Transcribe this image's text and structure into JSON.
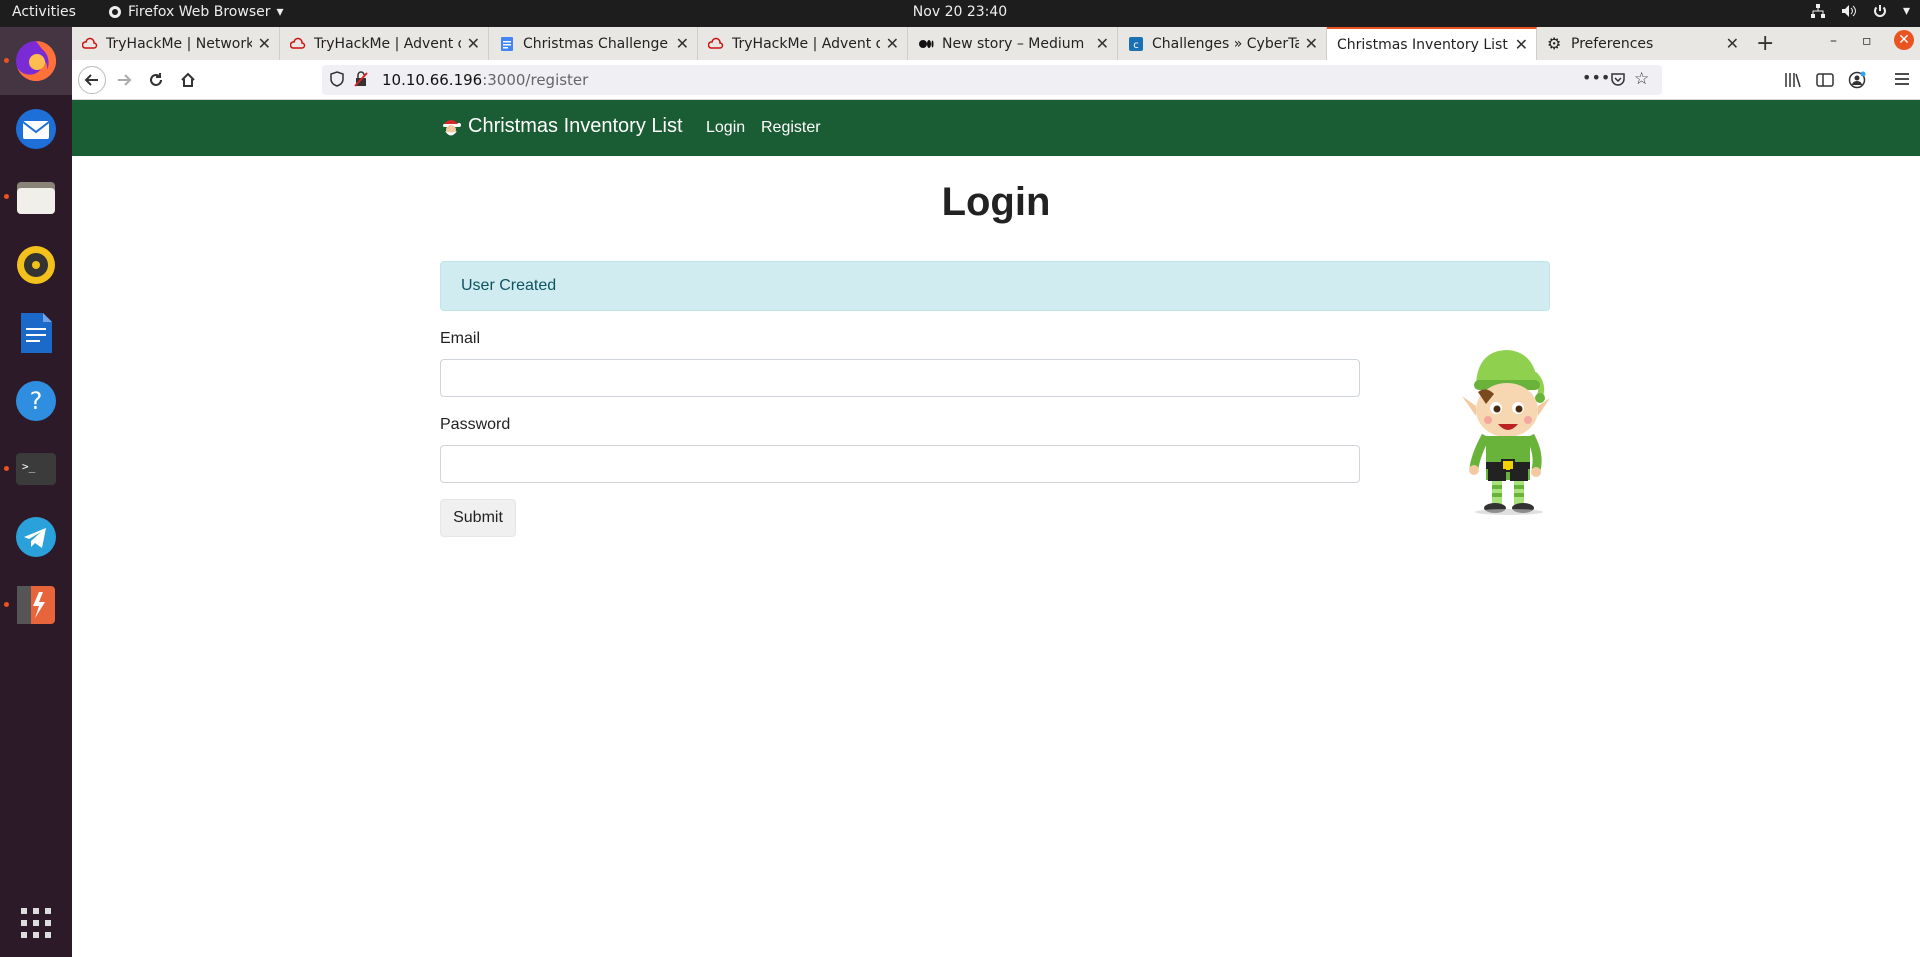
{
  "topbar": {
    "activities": "Activities",
    "app_name": "Firefox Web Browser",
    "clock": "Nov 20  23:40"
  },
  "dock": {
    "items": [
      "firefox",
      "thunderbird",
      "files",
      "rhythmbox",
      "libreoffice-writer",
      "help",
      "terminal",
      "telegram",
      "burp-suite",
      "show-applications"
    ]
  },
  "browser": {
    "tabs": [
      {
        "title": "TryHackMe | Network"
      },
      {
        "title": "TryHackMe | Advent o"
      },
      {
        "title": "Christmas Challenge D"
      },
      {
        "title": "TryHackMe | Advent o"
      },
      {
        "title": "New story – Medium"
      },
      {
        "title": "Challenges » CyberTal"
      },
      {
        "title": "Christmas Inventory List |"
      },
      {
        "title": "Preferences"
      }
    ],
    "new_tab": "+",
    "url_host": "10.10.66.196",
    "url_path": ":3000/register"
  },
  "site": {
    "brand": "Christmas Inventory List",
    "nav_login": "Login",
    "nav_register": "Register",
    "heading": "Login",
    "alert": "User Created",
    "email_label": "Email",
    "password_label": "Password",
    "submit": "Submit"
  },
  "colors": {
    "navbar": "#1a5c33",
    "alert_bg": "#d1ecf1",
    "alert_text": "#0c5460",
    "accent": "#e95420"
  }
}
